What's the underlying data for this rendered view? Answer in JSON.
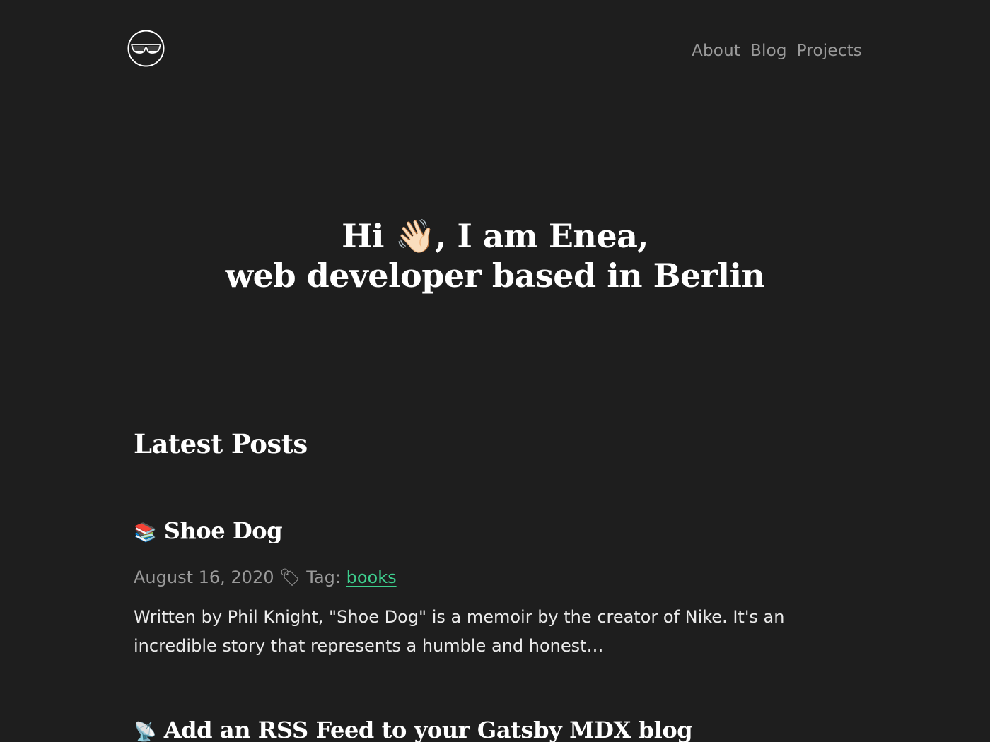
{
  "header": {
    "logo_icon": "sunglasses-logo-icon",
    "nav": [
      {
        "label": "About"
      },
      {
        "label": "Blog"
      },
      {
        "label": "Projects"
      }
    ]
  },
  "hero": {
    "line1": "Hi 👋🏻, I am Enea,",
    "line2": "web developer based in Berlin"
  },
  "latest": {
    "heading": "Latest Posts",
    "posts": [
      {
        "emoji": "📚",
        "title": "Shoe Dog",
        "date": "August 16, 2020",
        "meta_separator": "🏷",
        "tag_label": "Tag:",
        "tag": "books",
        "excerpt": "Written by Phil Knight, \"Shoe Dog\" is a memoir by the creator of Nike. It's an incredible story that represents a humble and honest…"
      },
      {
        "emoji": "📡",
        "title": "Add an RSS Feed to your Gatsby MDX blog"
      }
    ]
  },
  "colors": {
    "background": "#1e1e1e",
    "heading": "#ffffff",
    "muted": "#9a9a9a",
    "accent": "#3ecf8e"
  }
}
